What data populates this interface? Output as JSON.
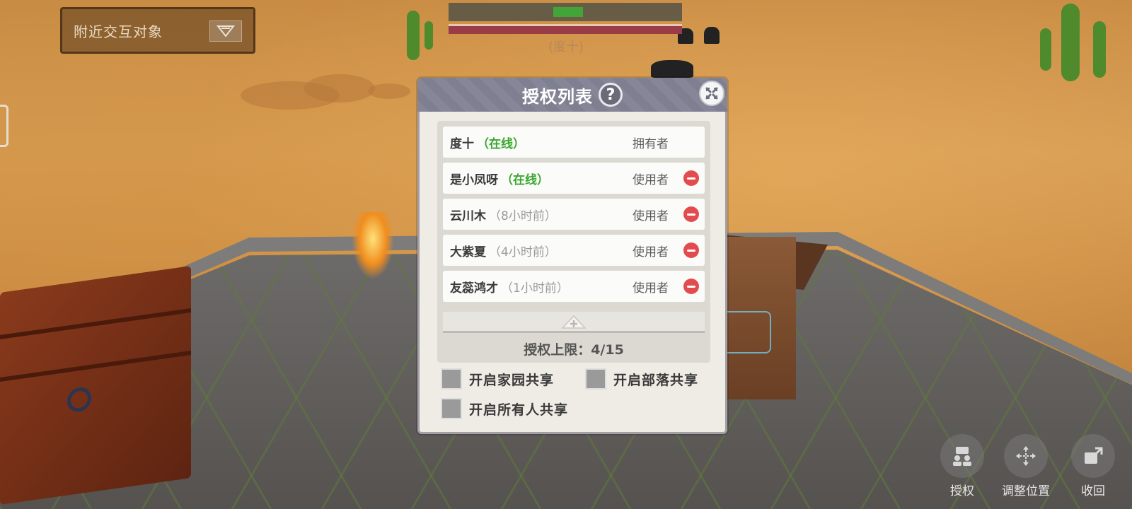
{
  "hud": {
    "nearby_label": "附近交互对象",
    "owner_tag": "(度十)"
  },
  "dialog": {
    "title": "授权列表",
    "help_symbol": "?",
    "entries": [
      {
        "name": "度十",
        "status": "（在线）",
        "online": true,
        "role": "拥有者",
        "removable": false
      },
      {
        "name": "是小凤呀",
        "status": "（在线）",
        "online": true,
        "role": "使用者",
        "removable": true
      },
      {
        "name": "云川木",
        "status": "（8小时前）",
        "online": false,
        "role": "使用者",
        "removable": true
      },
      {
        "name": "大紫夏",
        "status": "（4小时前）",
        "online": false,
        "role": "使用者",
        "removable": true
      },
      {
        "name": "友蕊鸿才",
        "status": "（1小时前）",
        "online": false,
        "role": "使用者",
        "removable": true
      }
    ],
    "limit_text": "授权上限：4/15",
    "share_options": [
      {
        "label": "开启家园共享",
        "checked": false
      },
      {
        "label": "开启部落共享",
        "checked": false
      },
      {
        "label": "开启所有人共享",
        "checked": false
      }
    ]
  },
  "actions": [
    {
      "label": "授权",
      "icon": "authorize-icon"
    },
    {
      "label": "调整位置",
      "icon": "move-icon"
    },
    {
      "label": "收回",
      "icon": "recall-icon"
    }
  ],
  "colors": {
    "online_green": "#3aa72f",
    "remove_red": "#e24c4f",
    "header_gray": "#7f7f92",
    "panel_bg": "#efece6"
  }
}
